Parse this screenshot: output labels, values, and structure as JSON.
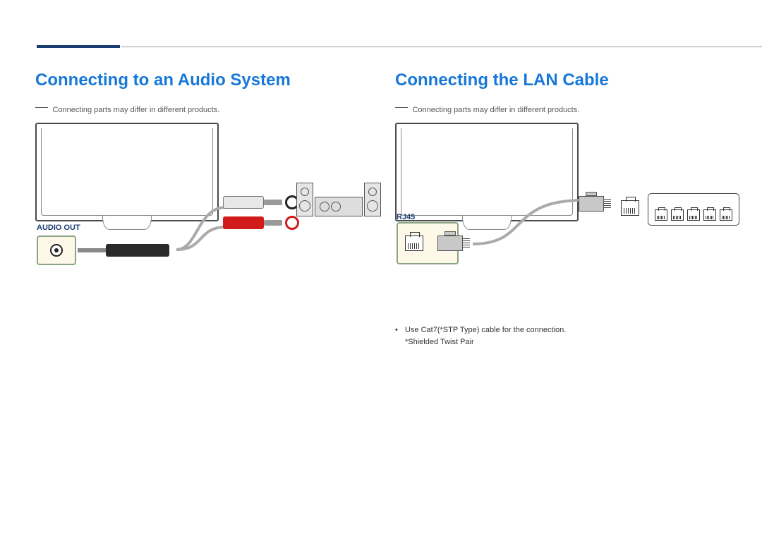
{
  "left": {
    "title": "Connecting to an Audio System",
    "note": "Connecting parts may differ in different products.",
    "port_label": "AUDIO OUT"
  },
  "right": {
    "title": "Connecting the LAN Cable",
    "note": "Connecting parts may differ in different products.",
    "port_label": "RJ45",
    "bullet_line1": "Use Cat7(*STP Type) cable for the connection.",
    "bullet_line2": "*Shielded Twist Pair"
  }
}
